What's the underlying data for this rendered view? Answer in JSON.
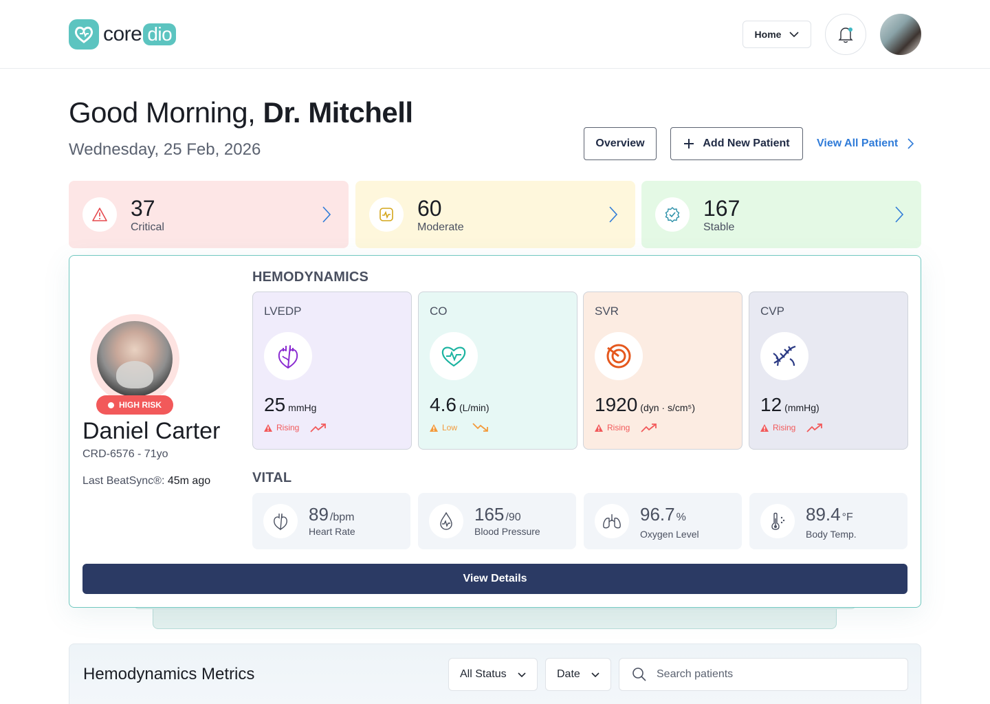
{
  "header": {
    "logo_core": "core",
    "logo_dio": "dio",
    "nav_dropdown": "Home"
  },
  "greeting": {
    "prefix": "Good Morning, ",
    "name": "Dr. Mitchell",
    "date": "Wednesday, 25 Feb, 2026"
  },
  "actions": {
    "overview": "Overview",
    "add_patient": "Add New Patient",
    "view_all": "View All Patient"
  },
  "status": [
    {
      "count": "37",
      "label": "Critical",
      "bg": "#fde6e6",
      "accent": "#e5484d",
      "chevron": "#2f7bd8"
    },
    {
      "count": "60",
      "label": "Moderate",
      "bg": "#fef7dc",
      "accent": "#d4a51a",
      "chevron": "#2f7bd8"
    },
    {
      "count": "167",
      "label": "Stable",
      "bg": "#e4f9e5",
      "accent": "#2a8fa8",
      "chevron": "#2f7bd8"
    }
  ],
  "patient": {
    "risk_badge": "HIGH RISK",
    "name": "Daniel Carter",
    "id_age": "CRD-6576 - 71yo",
    "sync_label": "Last BeatSync®: ",
    "sync_value": "45m ago",
    "hemo_title": "HEMODYNAMICS",
    "vital_title": "VITAL",
    "hemodynamics": [
      {
        "title": "LVEDP",
        "value": "25",
        "unit": "mmHg",
        "trend": "Rising",
        "bg": "#f0ecfb",
        "icon": "heart-organ-icon",
        "color": "#8a2bd1",
        "trend_color": "#f2595a"
      },
      {
        "title": "CO",
        "value": "4.6",
        "unit": "(L/min)",
        "trend": "Low",
        "bg": "#e7f8f5",
        "icon": "heart-pulse-icon",
        "color": "#1ab3a0",
        "trend_color": "#f39a3b"
      },
      {
        "title": "SVR",
        "value": "1920",
        "unit": "(dyn · s/cm⁵)",
        "trend": "Rising",
        "bg": "#fcece2",
        "icon": "target-icon",
        "color": "#e5581e",
        "trend_color": "#f2595a"
      },
      {
        "title": "CVP",
        "value": "12",
        "unit": "(mmHg)",
        "trend": "Rising",
        "bg": "#e8e9f2",
        "icon": "vessels-icon",
        "color": "#2b3a84",
        "trend_color": "#f2595a"
      }
    ],
    "vitals": [
      {
        "value": "89",
        "unit": "/bpm",
        "label": "Heart Rate",
        "icon": "heart-outline-icon"
      },
      {
        "value": "165",
        "unit": "/90",
        "label": "Blood Pressure",
        "icon": "blood-drop-icon"
      },
      {
        "value": "96.7",
        "unit": "%",
        "label": "Oxygen Level",
        "icon": "lungs-icon"
      },
      {
        "value": "89.4",
        "unit": "°F",
        "label": "Body Temp.",
        "icon": "thermometer-icon"
      }
    ],
    "view_details": "View Details"
  },
  "metrics": {
    "title": "Hemodynamics Metrics",
    "status_filter": "All Status",
    "date_filter": "Date",
    "search_placeholder": "Search patients"
  }
}
